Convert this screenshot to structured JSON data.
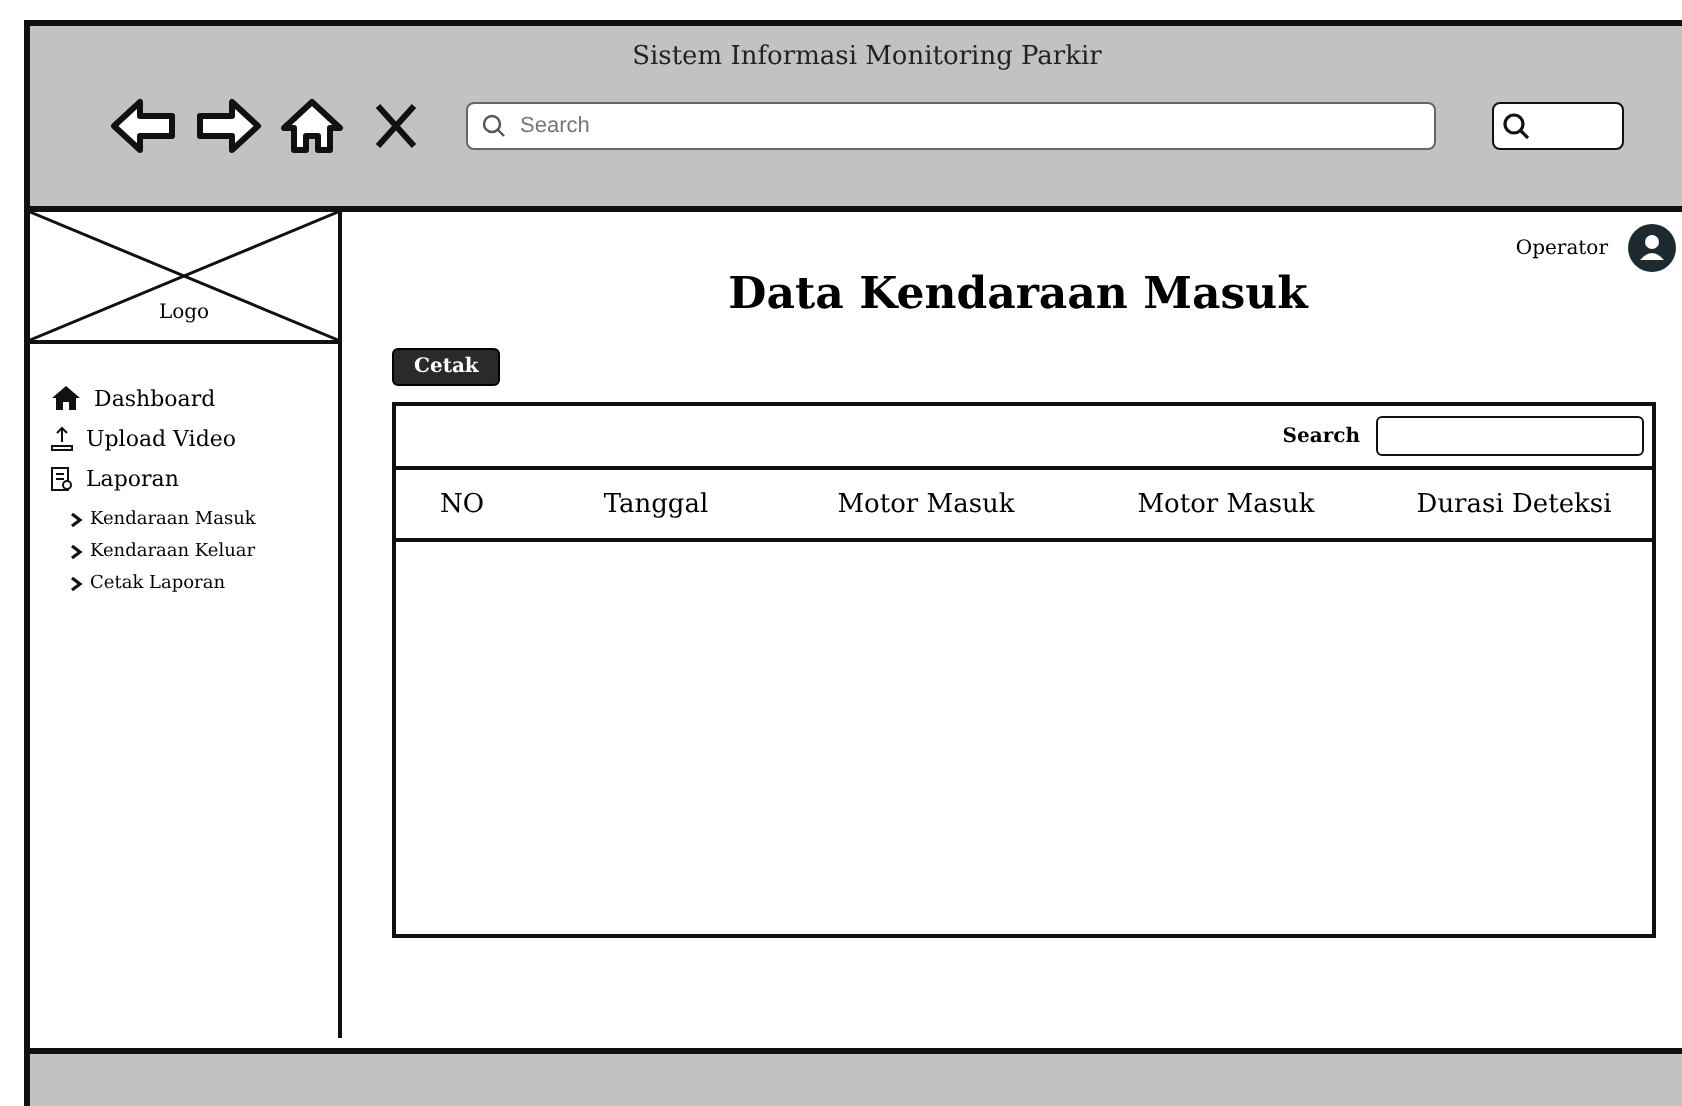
{
  "window": {
    "title": "Sistem Informasi Monitoring Parkir"
  },
  "toolbar": {
    "search": {
      "placeholder": "Search"
    }
  },
  "sidebar": {
    "logo": "Logo",
    "items": [
      {
        "label": "Dashboard",
        "kind": "home"
      },
      {
        "label": "Upload Video",
        "kind": "upload"
      },
      {
        "label": "Laporan",
        "kind": "report",
        "children": [
          {
            "label": "Kendaraan Masuk"
          },
          {
            "label": "Kendaraan Keluar"
          },
          {
            "label": "Cetak Laporan"
          }
        ]
      }
    ]
  },
  "user": {
    "name": "Operator"
  },
  "page": {
    "title": "Data Kendaraan Masuk",
    "print_button": "Cetak"
  },
  "table": {
    "search_label": "Search",
    "columns": [
      "NO",
      "Tanggal",
      "Motor Masuk",
      "Motor Masuk",
      "Durasi Deteksi"
    ]
  }
}
